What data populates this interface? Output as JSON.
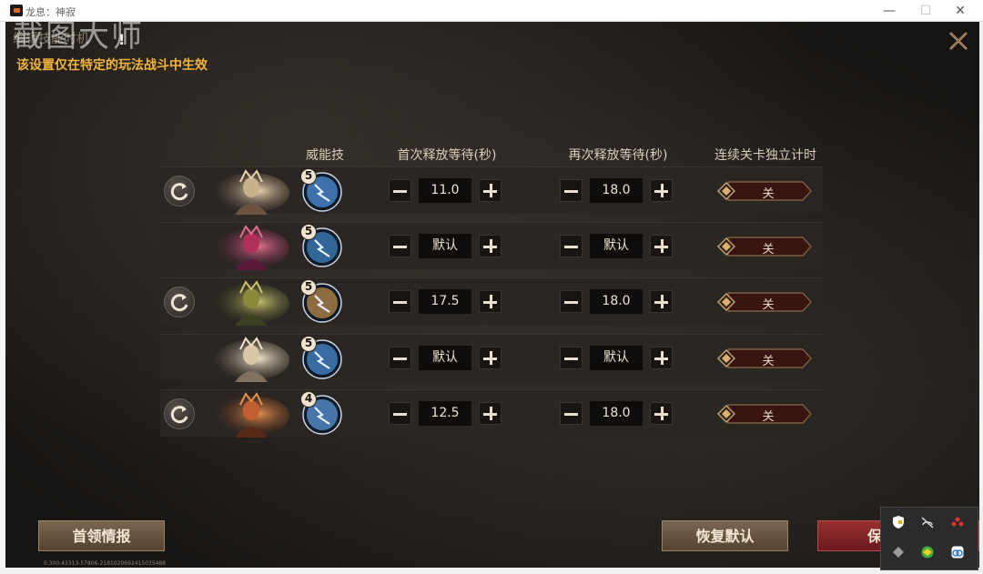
{
  "window": {
    "title": "龙息：神寂",
    "min_glyph": "—",
    "max_glyph": "☐",
    "close_glyph": "✕"
  },
  "watermark": "截图大师",
  "dialog": {
    "title": "编辑技能时机",
    "warn_mark": "!",
    "notice": "该设置仅在特定的玩法战斗中生效"
  },
  "columns": {
    "skill": "威能技",
    "first_wait": "首次释放等待(秒)",
    "repeat_wait": "再次释放等待(秒)",
    "stage_timer": "连续关卡独立计时"
  },
  "rows": [
    {
      "skill_level": "5",
      "first_wait": "11.0",
      "repeat_wait": "18.0",
      "toggle": "关",
      "has_reset": true,
      "skill_color": "#4f8fd9",
      "hero": "hero-1"
    },
    {
      "skill_level": "5",
      "first_wait": "默认",
      "repeat_wait": "默认",
      "toggle": "关",
      "has_reset": false,
      "skill_color": "#3f7fbf",
      "hero": "hero-2"
    },
    {
      "skill_level": "5",
      "first_wait": "17.5",
      "repeat_wait": "18.0",
      "toggle": "关",
      "has_reset": true,
      "skill_color": "#b88a4a",
      "hero": "hero-3"
    },
    {
      "skill_level": "5",
      "first_wait": "默认",
      "repeat_wait": "默认",
      "toggle": "关",
      "has_reset": false,
      "skill_color": "#4a88cf",
      "hero": "hero-4"
    },
    {
      "skill_level": "4",
      "first_wait": "12.5",
      "repeat_wait": "18.0",
      "toggle": "关",
      "has_reset": true,
      "skill_color": "#5a96d6",
      "hero": "hero-5"
    }
  ],
  "buttons": {
    "boss_info": "首领情报",
    "restore_default": "恢复默认",
    "save": "保存"
  },
  "version": "0.300.43313-57806-2181020692415035488",
  "colors": {
    "notice": "#f2b43a",
    "save_red": "#9a2f2f",
    "brown_button": "#6b5640"
  }
}
